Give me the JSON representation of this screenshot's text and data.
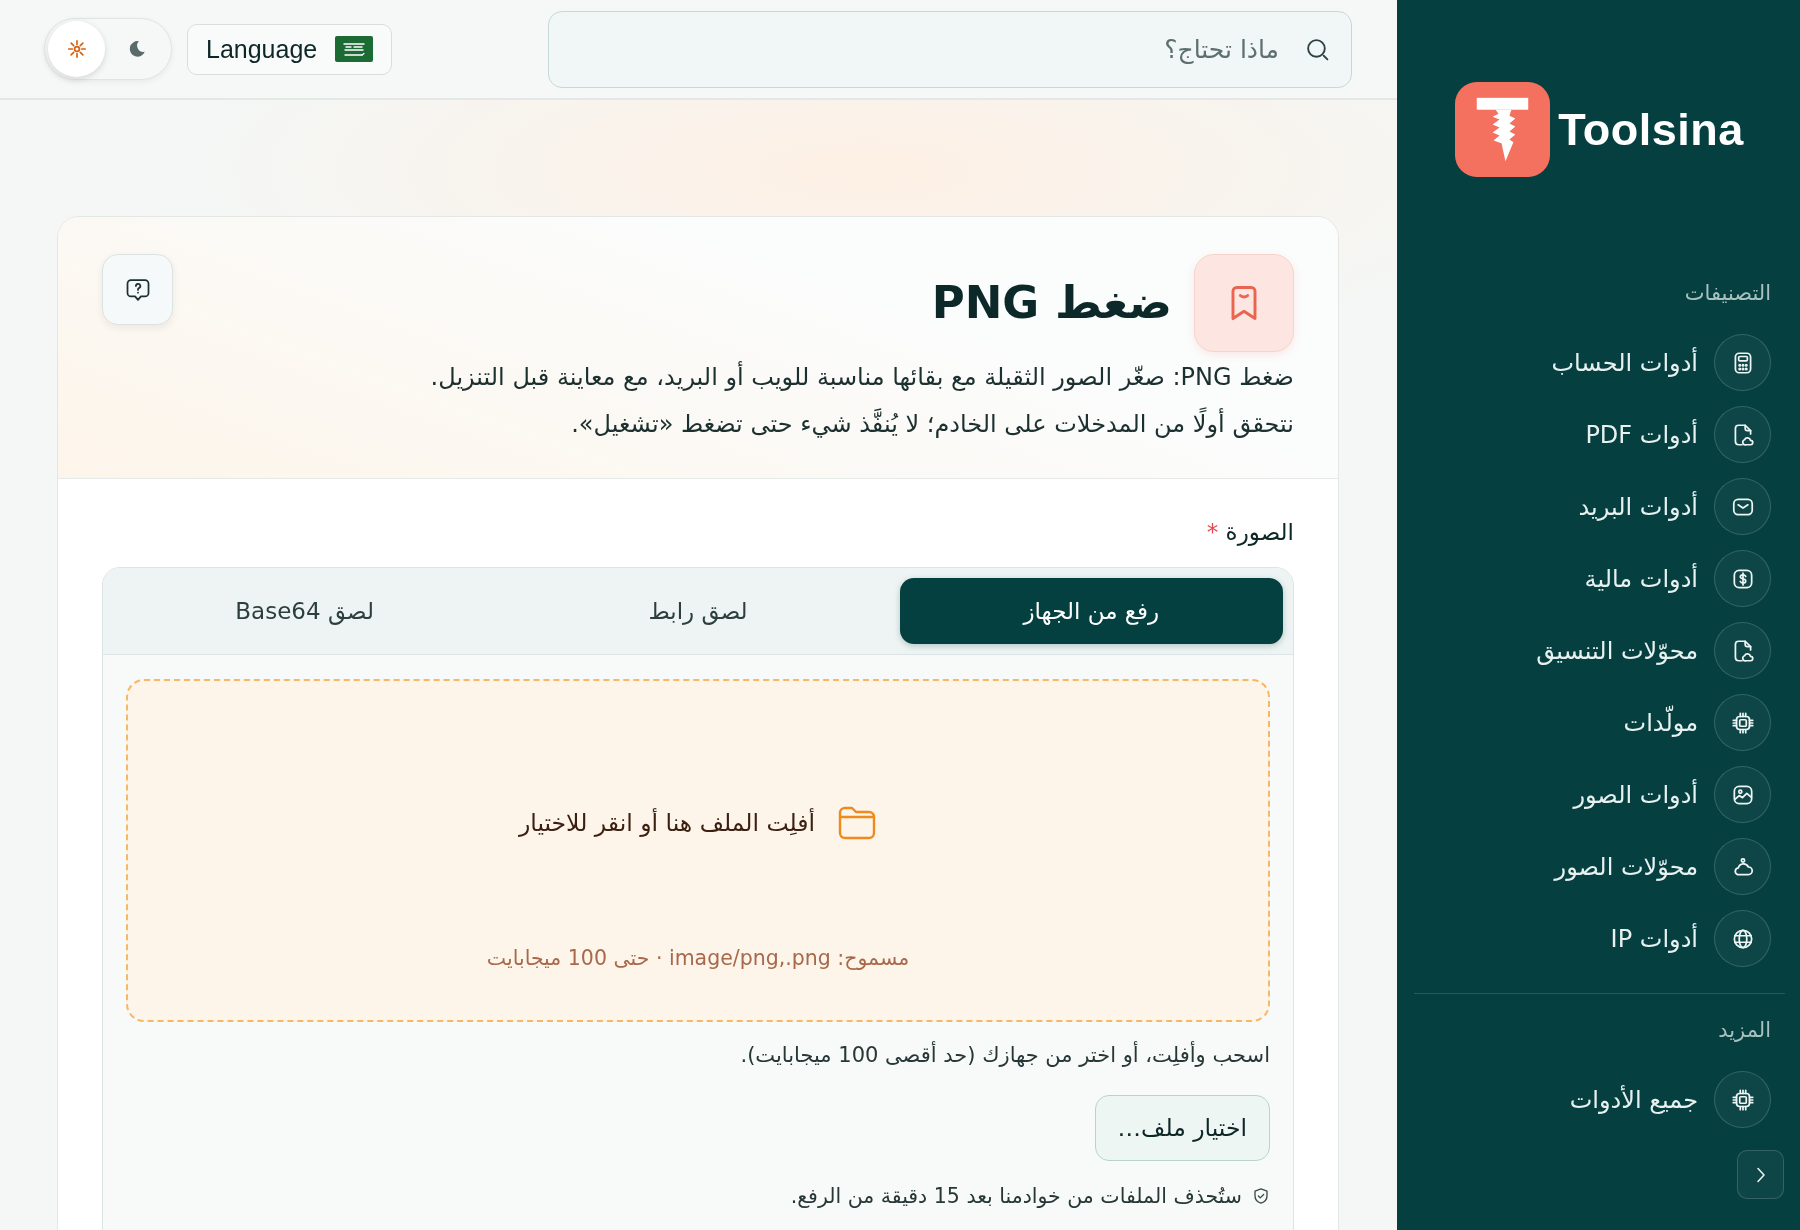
{
  "sidebar": {
    "logo": "Toolsina",
    "sections": [
      {
        "title": "التصنيفات",
        "items": [
          {
            "label": "أدوات الحساب"
          },
          {
            "label": "أدوات PDF"
          },
          {
            "label": "أدوات البريد"
          },
          {
            "label": "أدوات مالية"
          },
          {
            "label": "محوّلات التنسيق"
          },
          {
            "label": "مولّدات"
          },
          {
            "label": "أدوات الصور"
          },
          {
            "label": "محوّلات الصور"
          },
          {
            "label": "أدوات IP"
          }
        ]
      },
      {
        "title": "المزيد",
        "items": [
          {
            "label": "جميع الأدوات"
          }
        ]
      }
    ]
  },
  "topbar": {
    "search": {
      "placeholder": "ماذا تحتاج؟"
    },
    "language_button": {
      "label": "Language"
    },
    "theme_toggle": [
      {
        "selected": true
      },
      {
        "selected": false
      }
    ]
  },
  "tool": {
    "title": "ضغط PNG",
    "description": [
      "ضغط PNG: صغّر الصور الثقيلة مع بقائها مناسبة للويب أو البريد، مع معاينة قبل التنزيل.",
      "نتحقق أولًا من المدخلات على الخادم؛ لا يُنفَّذ شيء حتى تضغط «تشغيل»."
    ],
    "field": {
      "label": "الصورة",
      "required_mark": "*"
    },
    "source_tabs": [
      {
        "label": "رفع من الجهاز",
        "selected": true
      },
      {
        "label": "لصق رابط",
        "selected": false
      },
      {
        "label": "لصق Base64",
        "selected": false
      }
    ],
    "dropzone": {
      "prompt": "أفلِت الملف هنا أو انقر للاختيار",
      "allowed": "مسموح: image/png,.png · حتى 100 ميجابايت"
    },
    "hint": "اسحب وأفلِت، أو اختر من جهازك (حد أقصى 100 ميجابايت).",
    "choose_button": "اختيار ملف…",
    "retention_note": "ستُحذف الملفات من خوادمنا بعد 15 دقيقة من الرفع."
  }
}
